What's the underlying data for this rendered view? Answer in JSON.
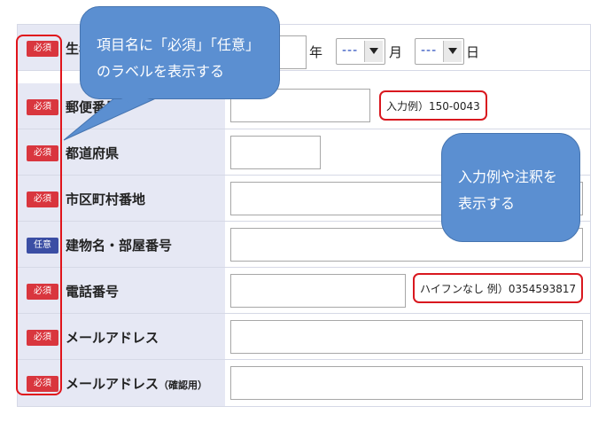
{
  "rows": [
    {
      "badge": "必須",
      "label": "生年月日",
      "type": "required"
    },
    {
      "badge": "必須",
      "label": "郵便番号",
      "type": "required",
      "example": "入力例）150-0043"
    },
    {
      "badge": "必須",
      "label": "都道府県",
      "type": "required"
    },
    {
      "badge": "必須",
      "label": "市区町村番地",
      "type": "required"
    },
    {
      "badge": "任意",
      "label": "建物名・部屋番号",
      "type": "optional"
    },
    {
      "badge": "必須",
      "label": "電話番号",
      "type": "required",
      "example": "ハイフンなし 例）0354593817"
    },
    {
      "badge": "必須",
      "label": "メールアドレス",
      "type": "required"
    },
    {
      "badge": "必須",
      "label": "メールアドレス",
      "label_small": "（確認用）",
      "type": "required"
    }
  ],
  "birth": {
    "year_unit": "年",
    "month_value": "---",
    "month_unit": "月",
    "day_value": "---",
    "day_unit": "日"
  },
  "callouts": {
    "badges_line1": "項目名に「必須」「任意」",
    "badges_line2": "のラベルを表示する",
    "examples_line1": "入力例や注釈を",
    "examples_line2": "表示する"
  },
  "colors": {
    "required": "#d9363e",
    "optional": "#3b4ea4",
    "label_bg": "#e6e8f4",
    "callout": "#5b8fd1",
    "highlight": "#e0141b"
  }
}
